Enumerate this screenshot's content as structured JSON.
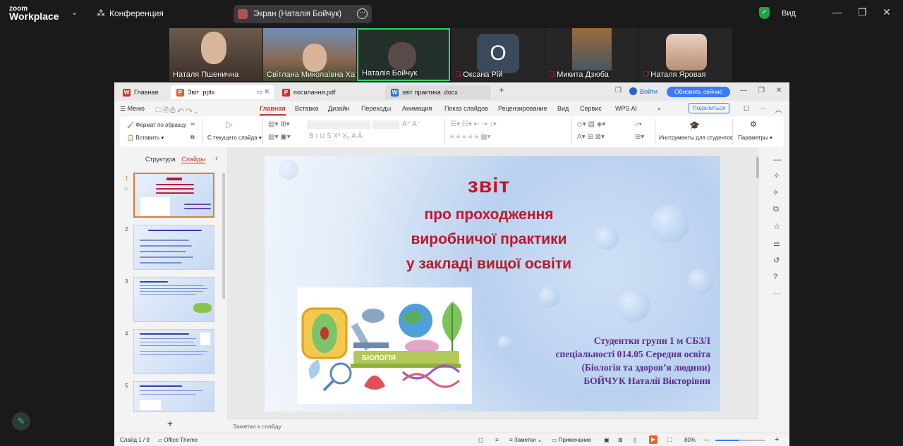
{
  "zoom": {
    "logo_line1": "zoom",
    "logo_line2": "Workplace",
    "meeting_label": "Конференция",
    "share_label": "Экран (Наталія Бойчук)",
    "view_label": "Вид",
    "participants": [
      {
        "name": "Наталя Пшенична",
        "muted": false
      },
      {
        "name": "Світлана Миколаївна Хат...",
        "muted": false
      },
      {
        "name": "Наталія Бойчук",
        "muted": false,
        "active_speaker": true
      },
      {
        "name": "Оксана Рій",
        "muted": true,
        "avatar_letter": "О"
      },
      {
        "name": "Микита Дзюба",
        "muted": true
      },
      {
        "name": "Наталя Яровая",
        "muted": true
      }
    ]
  },
  "wps": {
    "tabs": [
      {
        "label": "Главная",
        "icon": "W"
      },
      {
        "label": "Звіт .pptx",
        "icon": "P"
      },
      {
        "label": "посилання.pdf",
        "icon": "P"
      },
      {
        "label": "звіт практика .docx",
        "icon": "W"
      }
    ],
    "login_label": "Войти",
    "update_label": "Обновить сейчас",
    "menu_label": "Меню",
    "ribbon_tabs": [
      "Главная",
      "Вставка",
      "Дизайн",
      "Переходы",
      "Анимация",
      "Показ слайдов",
      "Рецензирование",
      "Вид",
      "Сервис",
      "WPS AI"
    ],
    "share_button": "Поделиться",
    "toolbar": {
      "format_painter": "Формат по образцу",
      "paste": "Вставить",
      "from_current": "С текущего слайда",
      "student_tools": "Инструменты для студентов",
      "params": "Параметры"
    },
    "panel_tabs": {
      "structure": "Структура",
      "slides": "Слайды"
    },
    "slide_numbers": [
      "1",
      "2",
      "3",
      "4",
      "5"
    ],
    "slide": {
      "title": "звіт",
      "line1": "про проходження",
      "line2": "виробничої  практики",
      "line3": "у закладі вищої освіти",
      "foot1": "Студентки групи 1 м СБЗЛ",
      "foot2": "спеціальності 014.05 Середня освіта",
      "foot3": "(Біологія та здоров’я людини)",
      "foot4": "БОЙЧУК Наталії Вікторівни",
      "book_label": "БІОЛОГІЯ"
    },
    "notes_placeholder": "Заметки к слайду",
    "status": {
      "slide_counter": "Слайд 1 / 9",
      "theme": "Office Theme",
      "notes": "Заметки",
      "comment": "Примечание",
      "zoom": "80%"
    }
  },
  "colors": {
    "accent_red": "#c0152a",
    "slide_purple": "#5b2d8e",
    "wps_blue": "#3a7cf5"
  }
}
